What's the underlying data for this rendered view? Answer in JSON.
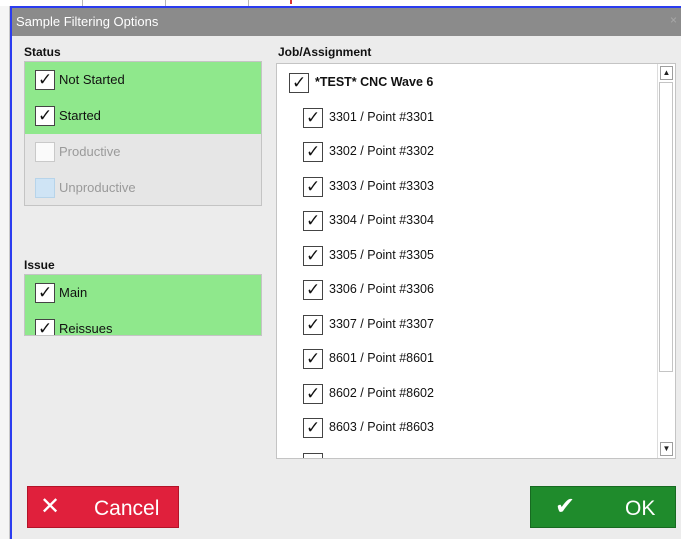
{
  "dialog": {
    "title": "Sample Filtering Options",
    "close_glyph": "×",
    "title_bar_color": "#8b8b8b",
    "border_color": "#2b3cf0"
  },
  "status": {
    "label": "Status",
    "options": [
      {
        "label": "Not Started",
        "checked": true,
        "enabled": true
      },
      {
        "label": "Started",
        "checked": true,
        "enabled": true
      },
      {
        "label": "Productive",
        "checked": false,
        "enabled": false
      },
      {
        "label": "Unproductive",
        "checked": false,
        "enabled": false
      }
    ]
  },
  "issue": {
    "label": "Issue",
    "options": [
      {
        "label": "Main",
        "checked": true
      },
      {
        "label": "Reissues",
        "checked": true
      }
    ]
  },
  "jobs": {
    "label": "Job/Assignment",
    "parent": {
      "label": "*TEST* CNC Wave 6",
      "checked": true
    },
    "items": [
      {
        "label": "3301 / Point #3301",
        "checked": true
      },
      {
        "label": "3302 / Point #3302",
        "checked": true
      },
      {
        "label": "3303 / Point #3303",
        "checked": true
      },
      {
        "label": "3304 / Point #3304",
        "checked": true
      },
      {
        "label": "3305 / Point #3305",
        "checked": true
      },
      {
        "label": "3306 / Point #3306",
        "checked": true
      },
      {
        "label": "3307 / Point #3307",
        "checked": true
      },
      {
        "label": "8601 / Point #8601",
        "checked": true
      },
      {
        "label": "8602 / Point #8602",
        "checked": true
      },
      {
        "label": "8603 / Point #8603",
        "checked": true
      }
    ]
  },
  "icons": {
    "check": "check-icon",
    "cancel": "x-icon",
    "ok": "checkmark-icon",
    "scroll_up": "scroll-up-arrow-icon",
    "scroll_down": "scroll-down-arrow-icon"
  },
  "buttons": {
    "cancel_label": "Cancel",
    "ok_label": "OK",
    "cancel_color": "#e0203c",
    "ok_color": "#1f8b2c"
  },
  "colors": {
    "checked_row": "#8fe88c"
  }
}
